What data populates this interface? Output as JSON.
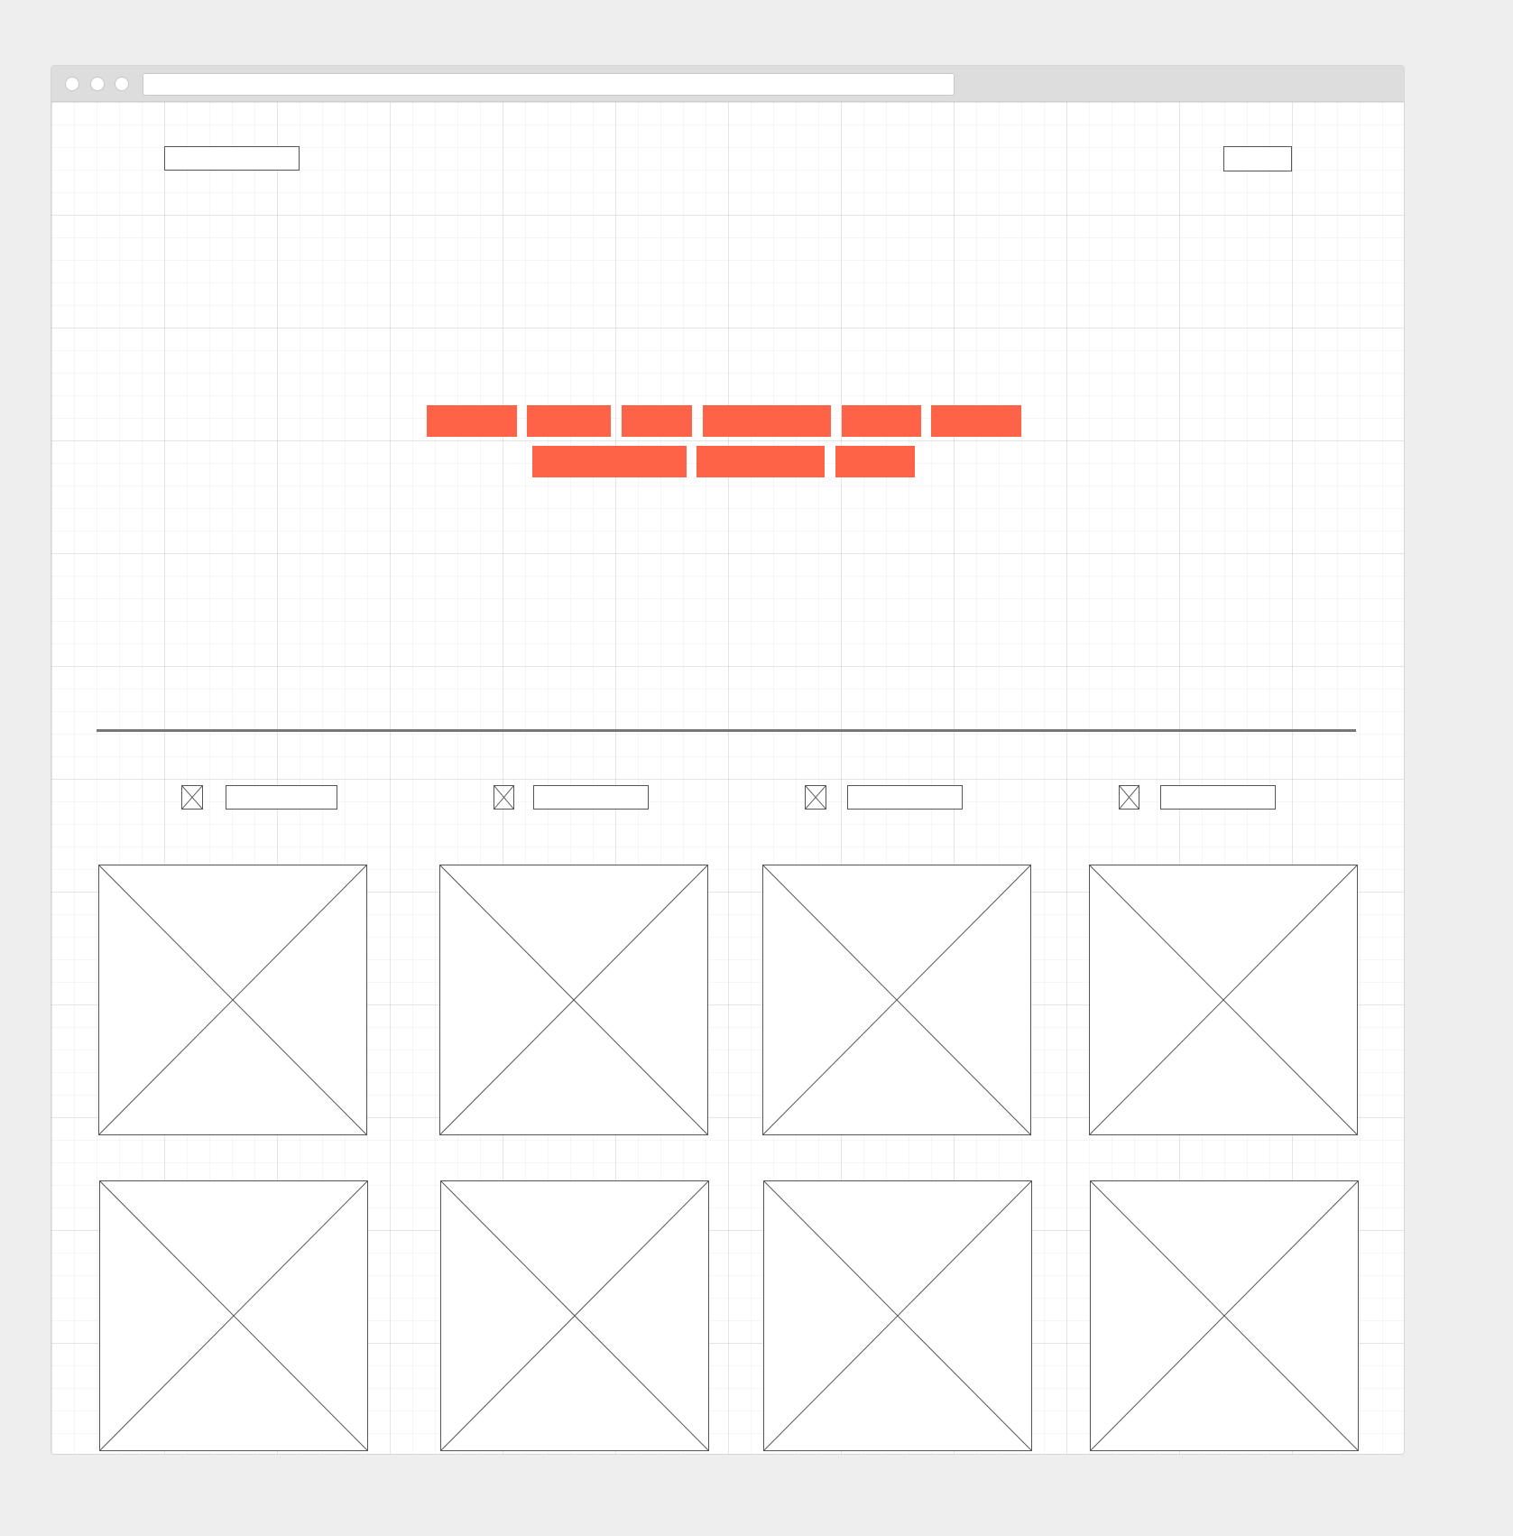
{
  "browser": {
    "url": "",
    "window_controls": [
      "close-dot",
      "minimize-dot",
      "maximize-dot"
    ]
  },
  "header": {
    "logo_text": "",
    "nav_button_label": ""
  },
  "hero": {
    "line1": [
      "",
      "",
      "",
      "",
      "",
      ""
    ],
    "line2": [
      "",
      "",
      ""
    ],
    "accent_color": "#ff6347"
  },
  "filters": [
    {
      "icon": "image-placeholder-icon",
      "label": ""
    },
    {
      "icon": "image-placeholder-icon",
      "label": ""
    },
    {
      "icon": "image-placeholder-icon",
      "label": ""
    },
    {
      "icon": "image-placeholder-icon",
      "label": ""
    }
  ],
  "gallery": {
    "rows": 2,
    "columns": 4,
    "placeholder_icon": "image-placeholder-icon",
    "item_count": 8
  },
  "colors": {
    "page_background": "#eeeeee",
    "chrome": "#dddddd",
    "stroke": "#555555",
    "accent": "#ff6347"
  }
}
